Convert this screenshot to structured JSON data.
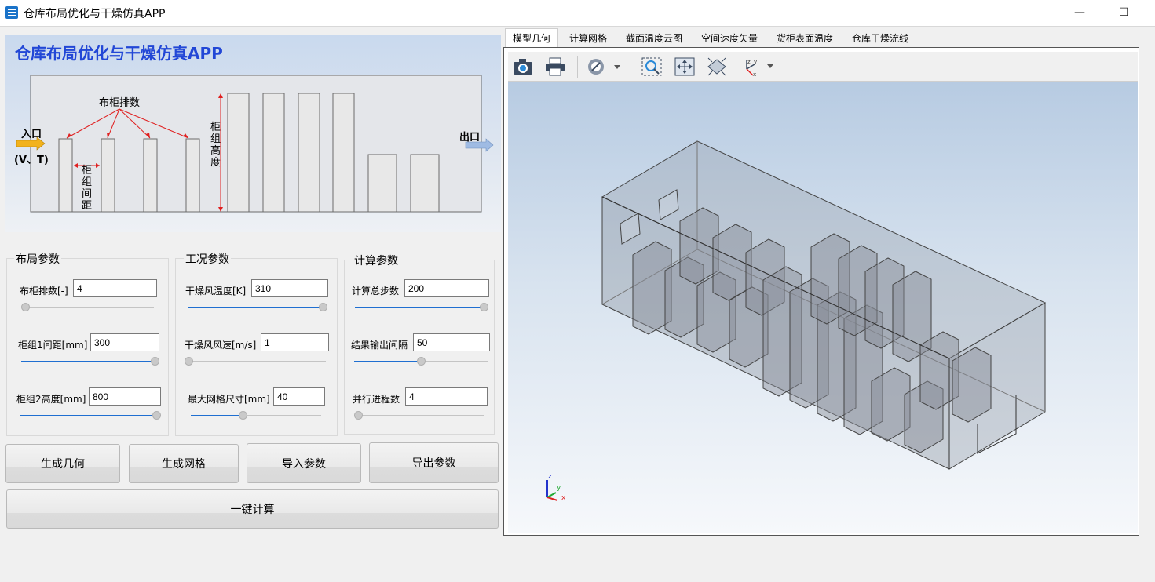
{
  "window": {
    "title": "仓库布局优化与干燥仿真APP",
    "minimize_glyph": "—",
    "maximize_glyph": "☐"
  },
  "banner": {
    "title": "仓库布局优化与干燥仿真APP",
    "inlet_label": "入口",
    "inlet_sub": "(V、T)",
    "outlet_label": "出口",
    "rows_label": "布柜排数",
    "spacing_label": "柜组间距",
    "height_label": "柜组高度"
  },
  "groups": {
    "layout": {
      "title": "布局参数",
      "params": [
        {
          "label": "布柜排数[-]",
          "value": "4",
          "slider": 0.0
        },
        {
          "label": "柜组1间距[mm]",
          "value": "300",
          "slider": 1.0
        },
        {
          "label": "柜组2高度[mm]",
          "value": "800",
          "slider": 1.0
        }
      ]
    },
    "condition": {
      "title": "工况参数",
      "params": [
        {
          "label": "干燥风温度[K]",
          "value": "310",
          "slider": 1.0
        },
        {
          "label": "干燥风风速[m/s]",
          "value": "1",
          "slider": 0.0
        },
        {
          "label": "最大网格尺寸[mm]",
          "value": "40",
          "slider": 0.4
        }
      ]
    },
    "compute": {
      "title": "计算参数",
      "params": [
        {
          "label": "计算总步数",
          "value": "200",
          "slider": 1.0
        },
        {
          "label": "结果输出间隔",
          "value": "50",
          "slider": 0.5
        },
        {
          "label": "并行进程数",
          "value": "4",
          "slider": 0.0
        }
      ]
    }
  },
  "buttons": {
    "gen_geometry": "生成几何",
    "gen_mesh": "生成网格",
    "import_params": "导入参数",
    "export_params": "导出参数",
    "one_click": "一键计算"
  },
  "tabs": [
    "模型几何",
    "计算网格",
    "截面温度云图",
    "空间速度矢量",
    "货柜表面温度",
    "仓库干燥流线"
  ],
  "active_tab": 0,
  "toolbar_icons": [
    "camera-icon",
    "print-icon",
    "hide-icon",
    "zoom-box-icon",
    "zoom-extents-icon",
    "view-fit-icon",
    "axis-view-icon"
  ],
  "triad": {
    "x": "x",
    "y": "y",
    "z": "z"
  },
  "colors": {
    "accent_blue": "#2247d6",
    "slider_fill": "#1f6fd1",
    "arrow_red": "#e02020",
    "inlet_arrow": "#f2b21c",
    "outlet_arrow": "#9fbbe3"
  }
}
